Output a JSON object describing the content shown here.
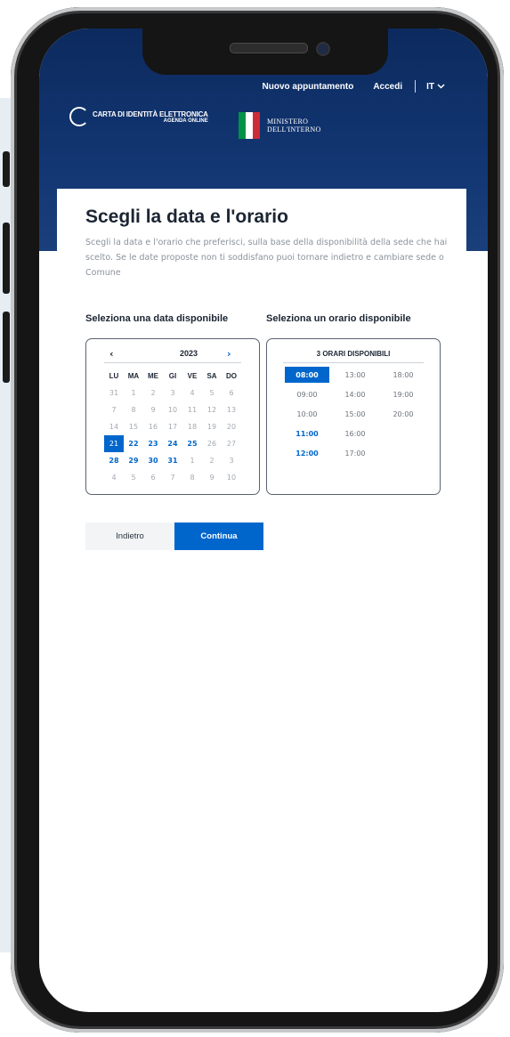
{
  "nav": {
    "new_appointment": "Nuovo appuntamento",
    "login": "Accedi",
    "language": "IT"
  },
  "brand": {
    "title": "CARTA DI IDENTITÀ ELETTRONICA",
    "subtitle": "AGENDA ONLINE"
  },
  "ministry": {
    "line1": "MINISTERO",
    "line2": "DELL'INTERNO"
  },
  "page": {
    "title": "Scegli la data e l'orario",
    "description": "Scegli la data e l'orario che preferisci, sulla base della disponibilità della sede che hai scelto. Se le date proposte non ti soddisfano puoi tornare indietro e cambiare sede o Comune",
    "dates_label": "Seleziona una data disponibile",
    "times_label": "Seleziona un orario disponibile"
  },
  "calendar": {
    "prev": "‹",
    "next": "›",
    "year": "2023",
    "weekdays": [
      "LU",
      "MA",
      "ME",
      "GI",
      "VE",
      "SA",
      "DO"
    ],
    "days": [
      {
        "d": "31",
        "s": "muted"
      },
      {
        "d": "1",
        "s": "muted"
      },
      {
        "d": "2",
        "s": "muted"
      },
      {
        "d": "3",
        "s": "muted"
      },
      {
        "d": "4",
        "s": "muted"
      },
      {
        "d": "5",
        "s": "muted"
      },
      {
        "d": "6",
        "s": "muted"
      },
      {
        "d": "7",
        "s": "muted"
      },
      {
        "d": "8",
        "s": "muted"
      },
      {
        "d": "9",
        "s": "muted"
      },
      {
        "d": "10",
        "s": "muted"
      },
      {
        "d": "11",
        "s": "muted"
      },
      {
        "d": "12",
        "s": "muted"
      },
      {
        "d": "13",
        "s": "muted"
      },
      {
        "d": "14",
        "s": "muted"
      },
      {
        "d": "15",
        "s": "muted"
      },
      {
        "d": "16",
        "s": "muted"
      },
      {
        "d": "17",
        "s": "muted"
      },
      {
        "d": "18",
        "s": "muted"
      },
      {
        "d": "19",
        "s": "muted"
      },
      {
        "d": "20",
        "s": "muted"
      },
      {
        "d": "21",
        "s": "selected"
      },
      {
        "d": "22",
        "s": "available"
      },
      {
        "d": "23",
        "s": "available"
      },
      {
        "d": "24",
        "s": "available"
      },
      {
        "d": "25",
        "s": "available"
      },
      {
        "d": "26",
        "s": "muted"
      },
      {
        "d": "27",
        "s": "muted"
      },
      {
        "d": "28",
        "s": "available"
      },
      {
        "d": "29",
        "s": "available"
      },
      {
        "d": "30",
        "s": "available"
      },
      {
        "d": "31",
        "s": "available"
      },
      {
        "d": "1",
        "s": "muted"
      },
      {
        "d": "2",
        "s": "muted"
      },
      {
        "d": "3",
        "s": "muted"
      },
      {
        "d": "4",
        "s": "muted"
      },
      {
        "d": "5",
        "s": "muted"
      },
      {
        "d": "6",
        "s": "muted"
      },
      {
        "d": "7",
        "s": "muted"
      },
      {
        "d": "8",
        "s": "muted"
      },
      {
        "d": "9",
        "s": "muted"
      },
      {
        "d": "10",
        "s": "muted"
      }
    ]
  },
  "times": {
    "header": "3 ORARI DISPONIBILI",
    "slots": [
      {
        "t": "08:00",
        "s": "selected"
      },
      {
        "t": "13:00",
        "s": "normal"
      },
      {
        "t": "18:00",
        "s": "normal"
      },
      {
        "t": "09:00",
        "s": "normal"
      },
      {
        "t": "14:00",
        "s": "normal"
      },
      {
        "t": "19:00",
        "s": "normal"
      },
      {
        "t": "10:00",
        "s": "normal"
      },
      {
        "t": "15:00",
        "s": "normal"
      },
      {
        "t": "20:00",
        "s": "normal"
      },
      {
        "t": "11:00",
        "s": "available"
      },
      {
        "t": "16:00",
        "s": "normal"
      },
      {
        "t": "",
        "s": "empty"
      },
      {
        "t": "12:00",
        "s": "available"
      },
      {
        "t": "17:00",
        "s": "normal"
      },
      {
        "t": "",
        "s": "empty"
      }
    ]
  },
  "buttons": {
    "back": "Indietro",
    "continue": "Continua"
  },
  "colors": {
    "header_blue": "#0c2a5e",
    "accent": "#0066cc",
    "flag": [
      "#009246",
      "#ffffff",
      "#ce2b37"
    ]
  }
}
